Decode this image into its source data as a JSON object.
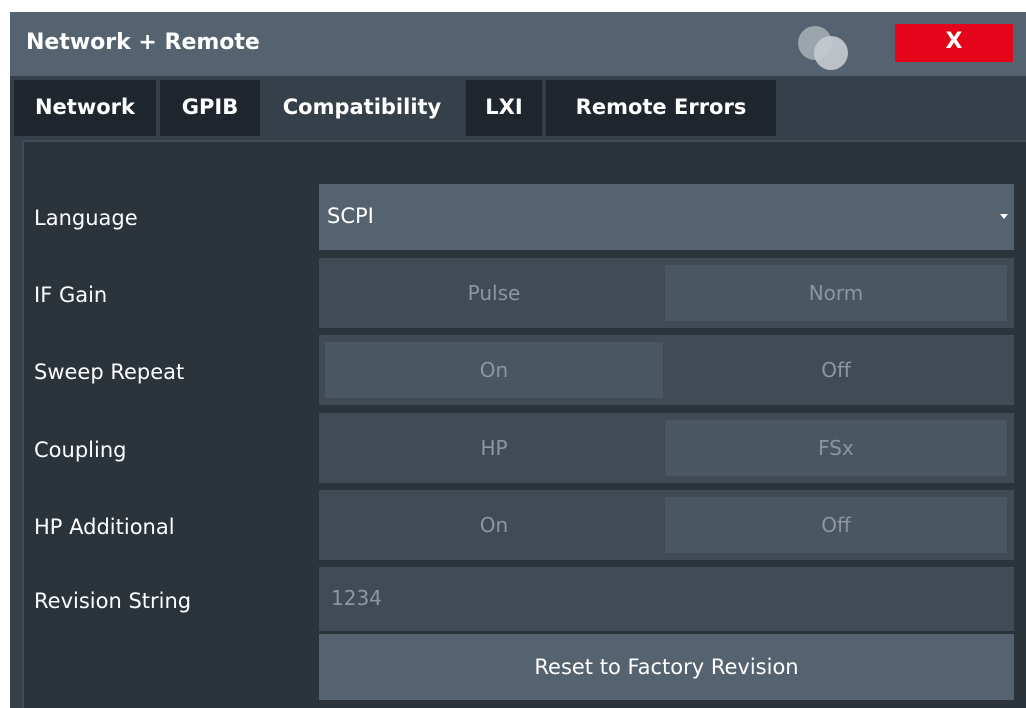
{
  "window": {
    "title": "Network + Remote",
    "close_label": "X",
    "close_color": "#e4051a"
  },
  "tabs": [
    {
      "label": "Network"
    },
    {
      "label": "GPIB"
    },
    {
      "label": "Compatibility",
      "active": true
    },
    {
      "label": "LXI"
    },
    {
      "label": "Remote Errors"
    }
  ],
  "settings": {
    "language": {
      "label": "Language",
      "value": "SCPI"
    },
    "if_gain": {
      "label": "IF Gain",
      "options": [
        "Pulse",
        "Norm"
      ]
    },
    "sweep_repeat": {
      "label": "Sweep Repeat",
      "options": [
        "On",
        "Off"
      ]
    },
    "coupling": {
      "label": "Coupling",
      "options": [
        "HP",
        "FSx"
      ]
    },
    "hp_additional": {
      "label": "HP Additional",
      "options": [
        "On",
        "Off"
      ]
    },
    "revision_string": {
      "label": "Revision String",
      "value": "1234"
    },
    "reset_button": {
      "label": "Reset to Factory Revision"
    }
  },
  "icons": {
    "logo": "rohde-schwarz-logo-icon",
    "dropdown": "dropdown-arrow-icon"
  }
}
